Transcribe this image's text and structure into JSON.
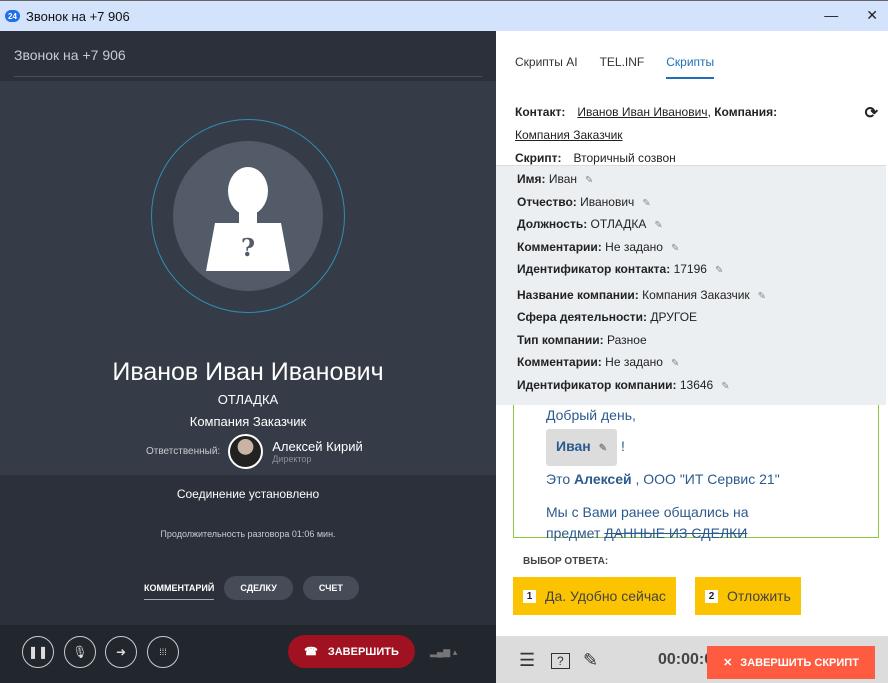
{
  "window": {
    "title": "Звонок на +7 906",
    "logo": "24"
  },
  "call": {
    "header": "Звонок на +7 906",
    "name": "Иванов Иван Иванович",
    "position": "ОТЛАДКА",
    "company": "Компания Заказчик",
    "responsible_label": "Ответственный:",
    "responsible_name": "Алексей Кирий",
    "responsible_position": "Директор",
    "status": "Соединение установлено",
    "duration": "Продолжительность разговора 01:06 мин.",
    "tabs": [
      "КОММЕНТАРИЙ",
      "СДЕЛКУ",
      "СЧЕТ"
    ],
    "end_label": "ЗАВЕРШИТЬ"
  },
  "right": {
    "tabs": [
      "Скрипты AI",
      "TEL.INF",
      "Скрипты"
    ],
    "contact_label": "Контакт:",
    "contact_value": "Иванов Иван Иванович",
    "company_label": "Компания:",
    "company_value": "Компания Заказчик",
    "script_label": "Скрипт:",
    "script_value": "Вторичный созвон",
    "fields": [
      {
        "label": "Имя:",
        "value": "Иван",
        "editable": true
      },
      {
        "label": "Отчество:",
        "value": "Иванович",
        "editable": true
      },
      {
        "label": "Должность:",
        "value": "ОТЛАДКА",
        "editable": true
      },
      {
        "label": "Комментарии:",
        "value": "Не задано",
        "editable": true
      },
      {
        "label": "Идентификатор контакта:",
        "value": "17196",
        "editable": true
      },
      {
        "label": "Название компании:",
        "value": "Компания Заказчик",
        "editable": true
      },
      {
        "label": "Сфера деятельности:",
        "value": "ДРУГОЕ",
        "editable": false
      },
      {
        "label": "Тип компании:",
        "value": "Разное",
        "editable": false
      },
      {
        "label": "Комментарии:",
        "value": "Не задано",
        "editable": true
      },
      {
        "label": "Идентификатор компании:",
        "value": "13646",
        "editable": true
      }
    ],
    "script": {
      "greeting": "Добрый день,",
      "name_chip": "Иван",
      "excl": "!",
      "this": "Это",
      "agent": "Алексей",
      "org": ", ООО \"ИТ Сервис 21\"",
      "line3": "Мы с Вами ранее общались на",
      "line4": "предмет",
      "struck": "ДАННЫЕ ИЗ СДЕЛКИ"
    },
    "answer_label": "ВЫБОР ОТВЕТА:",
    "answers": [
      {
        "num": "1",
        "label": "Да. Удобно сейчас"
      },
      {
        "num": "2",
        "label": "Отложить"
      }
    ],
    "timer": "00:00:0",
    "end_script": "ЗАВЕРШИТЬ СКРИПТ"
  }
}
